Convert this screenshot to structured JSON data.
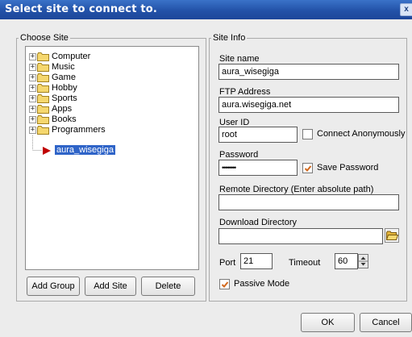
{
  "window": {
    "title": "Select site to connect to.",
    "close_label": "x"
  },
  "choose_site": {
    "legend": "Choose Site",
    "tree": [
      {
        "label": "Computer",
        "expander": "+"
      },
      {
        "label": "Music",
        "expander": "+"
      },
      {
        "label": "Game",
        "expander": "+"
      },
      {
        "label": "Hobby",
        "expander": "+"
      },
      {
        "label": "Sports",
        "expander": "+"
      },
      {
        "label": "Apps",
        "expander": "+"
      },
      {
        "label": "Books",
        "expander": "+"
      },
      {
        "label": "Programmers",
        "expander": "+"
      }
    ],
    "selected_site": "aura_wisegiga",
    "buttons": {
      "add_group": "Add Group",
      "add_site": "Add Site",
      "delete": "Delete"
    }
  },
  "site_info": {
    "legend": "Site Info",
    "site_name": {
      "label": "Site name",
      "value": "aura_wisegiga"
    },
    "ftp_address": {
      "label": "FTP Address",
      "value": "aura.wisegiga.net"
    },
    "user_id": {
      "label": "User ID",
      "value": "root"
    },
    "connect_anonymously": {
      "label": "Connect Anonymously",
      "checked": false
    },
    "password": {
      "label": "Password",
      "value": "••••••••"
    },
    "save_password": {
      "label": "Save Password",
      "checked": true
    },
    "remote_directory": {
      "label": "Remote Directory (Enter absolute path)",
      "value": ""
    },
    "download_directory": {
      "label": "Download Directory",
      "value": ""
    },
    "port": {
      "label": "Port",
      "value": "21"
    },
    "timeout": {
      "label": "Timeout",
      "value": "60"
    },
    "passive_mode": {
      "label": "Passive Mode",
      "checked": true
    }
  },
  "footer": {
    "ok": "OK",
    "cancel": "Cancel"
  },
  "colors": {
    "title_bar": "#2352a8",
    "selection": "#2f64c8",
    "check": "#d2691e",
    "arrow": "#c00000",
    "folder": "#f5d76e"
  },
  "icons": {
    "close": "close-icon",
    "folder": "folder-icon",
    "expander": "plus-icon",
    "arrow": "arrow-right-icon",
    "browse": "folder-open-icon",
    "check": "checkmark-icon"
  }
}
